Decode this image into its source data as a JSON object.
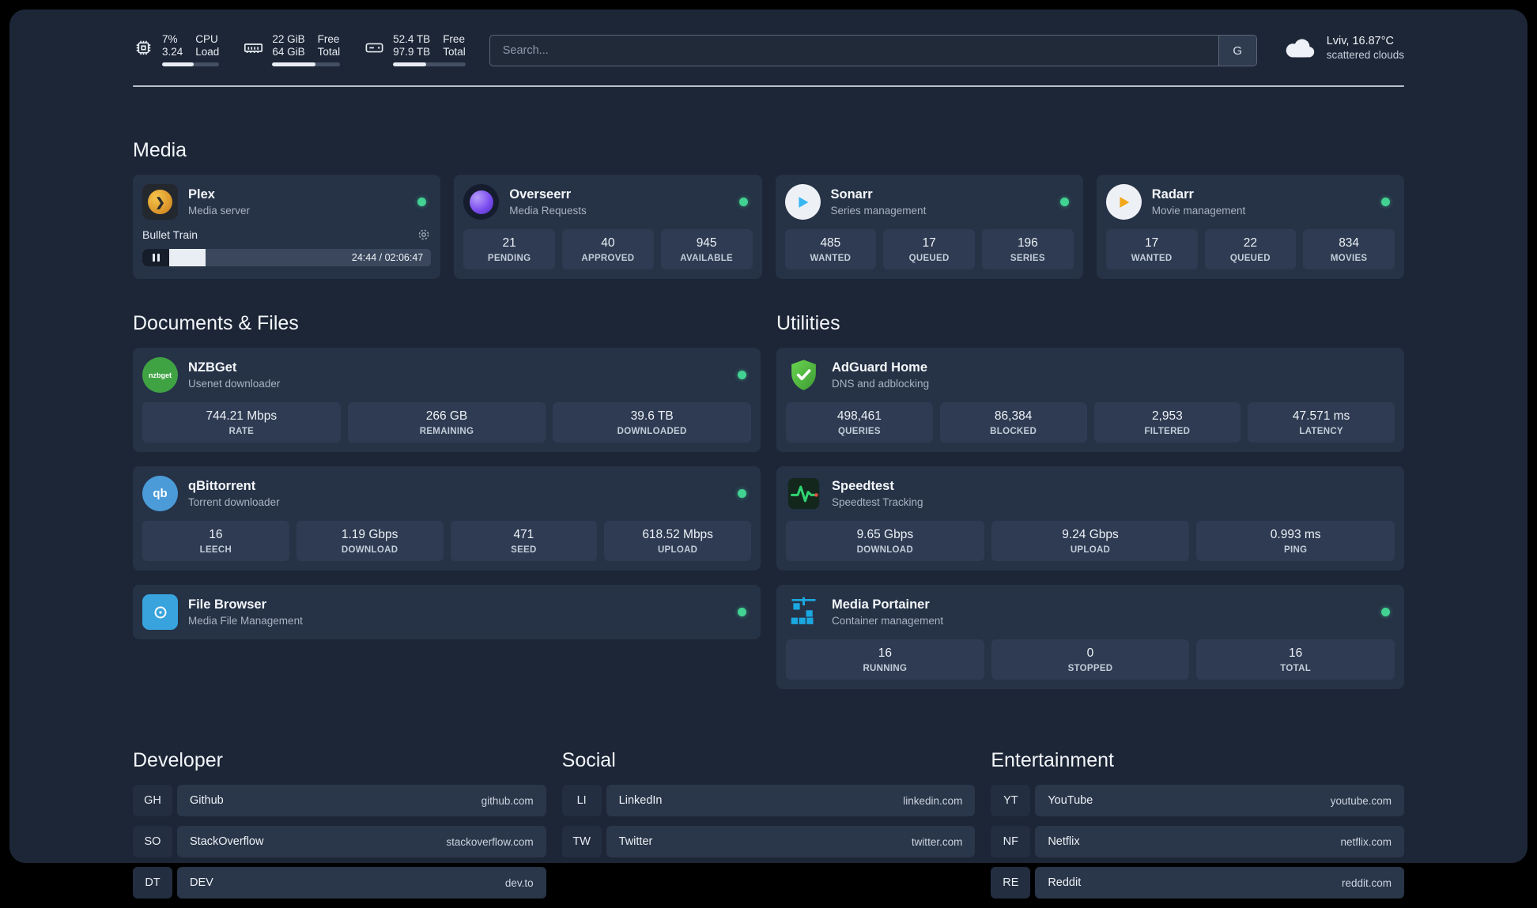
{
  "topbar": {
    "cpu": {
      "v1": "7%",
      "l1": "CPU",
      "v2": "3.24",
      "l2": "Load",
      "progress": 55
    },
    "memory": {
      "v1": "22 GiB",
      "l1": "Free",
      "v2": "64 GiB",
      "l2": "Total",
      "progress": 64
    },
    "disk": {
      "v1": "52.4 TB",
      "l1": "Free",
      "v2": "97.9 TB",
      "l2": "Total",
      "progress": 46
    },
    "search": {
      "placeholder": "Search...",
      "button_label": "G"
    },
    "weather": {
      "location": "Lviv, 16.87°C",
      "condition": "scattered clouds"
    }
  },
  "sections": {
    "media": {
      "title": "Media",
      "plex": {
        "name": "Plex",
        "subtitle": "Media server",
        "now_playing": "Bullet Train",
        "time": "24:44 / 02:06:47",
        "progress": 22
      },
      "overseerr": {
        "name": "Overseerr",
        "subtitle": "Media Requests",
        "stats": [
          {
            "value": "21",
            "label": "PENDING"
          },
          {
            "value": "40",
            "label": "APPROVED"
          },
          {
            "value": "945",
            "label": "AVAILABLE"
          }
        ]
      },
      "sonarr": {
        "name": "Sonarr",
        "subtitle": "Series management",
        "stats": [
          {
            "value": "485",
            "label": "WANTED"
          },
          {
            "value": "17",
            "label": "QUEUED"
          },
          {
            "value": "196",
            "label": "SERIES"
          }
        ]
      },
      "radarr": {
        "name": "Radarr",
        "subtitle": "Movie management",
        "stats": [
          {
            "value": "17",
            "label": "WANTED"
          },
          {
            "value": "22",
            "label": "QUEUED"
          },
          {
            "value": "834",
            "label": "MOVIES"
          }
        ]
      }
    },
    "documents": {
      "title": "Documents & Files",
      "nzbget": {
        "name": "NZBGet",
        "subtitle": "Usenet downloader",
        "stats": [
          {
            "value": "744.21 Mbps",
            "label": "RATE"
          },
          {
            "value": "266 GB",
            "label": "REMAINING"
          },
          {
            "value": "39.6 TB",
            "label": "DOWNLOADED"
          }
        ]
      },
      "qbittorrent": {
        "name": "qBittorrent",
        "subtitle": "Torrent downloader",
        "stats": [
          {
            "value": "16",
            "label": "LEECH"
          },
          {
            "value": "1.19 Gbps",
            "label": "DOWNLOAD"
          },
          {
            "value": "471",
            "label": "SEED"
          },
          {
            "value": "618.52 Mbps",
            "label": "UPLOAD"
          }
        ]
      },
      "filebrowser": {
        "name": "File Browser",
        "subtitle": "Media File Management"
      }
    },
    "utilities": {
      "title": "Utilities",
      "adguard": {
        "name": "AdGuard Home",
        "subtitle": "DNS and adblocking",
        "stats": [
          {
            "value": "498,461",
            "label": "QUERIES"
          },
          {
            "value": "86,384",
            "label": "BLOCKED"
          },
          {
            "value": "2,953",
            "label": "FILTERED"
          },
          {
            "value": "47.571 ms",
            "label": "LATENCY"
          }
        ]
      },
      "speedtest": {
        "name": "Speedtest",
        "subtitle": "Speedtest Tracking",
        "stats": [
          {
            "value": "9.65 Gbps",
            "label": "DOWNLOAD"
          },
          {
            "value": "9.24 Gbps",
            "label": "UPLOAD"
          },
          {
            "value": "0.993 ms",
            "label": "PING"
          }
        ]
      },
      "portainer": {
        "name": "Media Portainer",
        "subtitle": "Container management",
        "stats": [
          {
            "value": "16",
            "label": "RUNNING"
          },
          {
            "value": "0",
            "label": "STOPPED"
          },
          {
            "value": "16",
            "label": "TOTAL"
          }
        ]
      }
    }
  },
  "bookmarks": {
    "developer": {
      "title": "Developer",
      "items": [
        {
          "abbr": "GH",
          "name": "Github",
          "url": "github.com"
        },
        {
          "abbr": "SO",
          "name": "StackOverflow",
          "url": "stackoverflow.com"
        },
        {
          "abbr": "DT",
          "name": "DEV",
          "url": "dev.to"
        }
      ]
    },
    "social": {
      "title": "Social",
      "items": [
        {
          "abbr": "LI",
          "name": "LinkedIn",
          "url": "linkedin.com"
        },
        {
          "abbr": "TW",
          "name": "Twitter",
          "url": "twitter.com"
        }
      ]
    },
    "entertainment": {
      "title": "Entertainment",
      "items": [
        {
          "abbr": "YT",
          "name": "YouTube",
          "url": "youtube.com"
        },
        {
          "abbr": "NF",
          "name": "Netflix",
          "url": "netflix.com"
        },
        {
          "abbr": "RE",
          "name": "Reddit",
          "url": "reddit.com"
        }
      ]
    }
  }
}
